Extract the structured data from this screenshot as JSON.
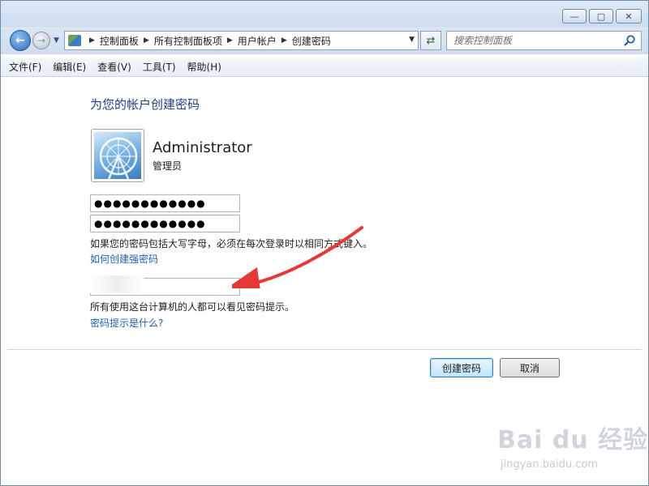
{
  "window": {
    "controls": {
      "minimize": "—",
      "maximize": "▢",
      "close": "✕"
    }
  },
  "address": {
    "breadcrumbs": [
      "控制面板",
      "所有控制面板项",
      "用户帐户",
      "创建密码"
    ]
  },
  "search": {
    "placeholder": "搜索控制面板"
  },
  "menu": [
    "文件(F)",
    "编辑(E)",
    "查看(V)",
    "工具(T)",
    "帮助(H)"
  ],
  "page": {
    "title": "为您的帐户创建密码",
    "user": {
      "name": "Administrator",
      "role": "管理员"
    },
    "new_password": "●●●●●●●●●●●●",
    "confirm_password": "●●●●●●●●●●●●",
    "caps_hint": "如果您的密码包括大写字母，必须在每次登录时以相同方式键入。",
    "strong_password_link": "如何创建强密码",
    "hint_visibility_note": "所有使用这台计算机的人都可以看见密码提示。",
    "hint_link": "密码提示是什么?",
    "create_button": "创建密码",
    "cancel_button": "取消"
  },
  "watermark": {
    "logo": "Bai du 经验",
    "url": "jingyan.baidu.com"
  },
  "colors": {
    "title_blue": "#1e3f8c",
    "link_blue": "#1e5fb4",
    "annotation_red": "#e53935"
  },
  "icons": {
    "back": "arrow-left-icon",
    "forward": "arrow-right-icon",
    "refresh": "refresh-icon",
    "search": "search-icon",
    "control_panel": "control-panel-icon",
    "user_picture": "user-picture-icon"
  }
}
